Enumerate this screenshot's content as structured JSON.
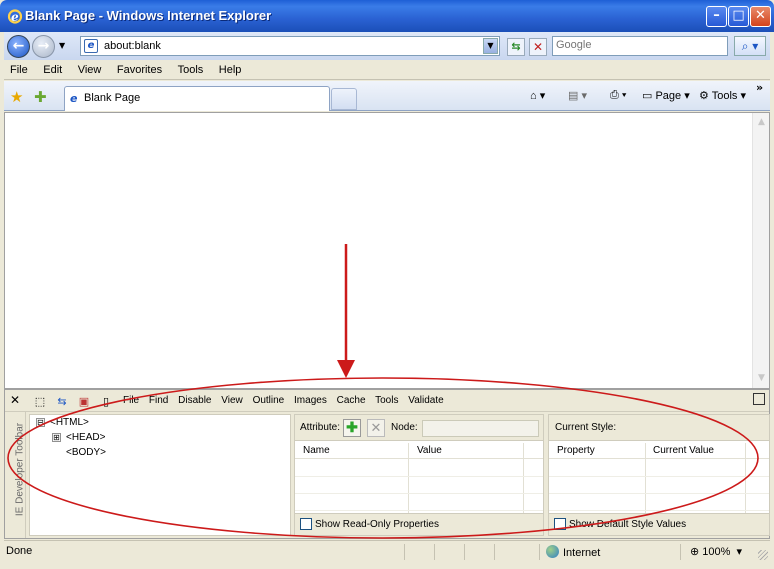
{
  "window": {
    "title": "Blank Page - Windows Internet Explorer",
    "minimize_icon": "minimize-icon",
    "maximize_icon": "maximize-icon",
    "close_icon": "close-icon"
  },
  "address_bar": {
    "url": "about:blank",
    "search_placeholder": "Google"
  },
  "menu": [
    "File",
    "Edit",
    "View",
    "Favorites",
    "Tools",
    "Help"
  ],
  "tabs": [
    {
      "label": "Blank Page",
      "active": true
    }
  ],
  "command_bar": {
    "page_label": "Page",
    "tools_label": "Tools"
  },
  "dev_toolbar": {
    "vertical_label": "IE Developer Toolbar",
    "menu": [
      "File",
      "Find",
      "Disable",
      "View",
      "Outline",
      "Images",
      "Cache",
      "Tools",
      "Validate"
    ],
    "tree": [
      {
        "label": "<HTML>",
        "expander": "⊟"
      },
      {
        "label": "<HEAD>",
        "expander": "⊞"
      },
      {
        "label": "<BODY>",
        "expander": ""
      }
    ],
    "attributes": {
      "label": "Attribute:",
      "node_label": "Node:",
      "columns": [
        "Name",
        "Value"
      ],
      "checkbox_label": "Show Read-Only Properties"
    },
    "styles": {
      "label": "Current Style:",
      "columns": [
        "Property",
        "Current Value"
      ],
      "checkbox_label": "Show Default Style Values"
    }
  },
  "status": {
    "text": "Done",
    "zone": "Internet",
    "zoom": "100%"
  },
  "colors": {
    "titlebar": "#2a61d2",
    "annotation": "#cc1a1a"
  }
}
